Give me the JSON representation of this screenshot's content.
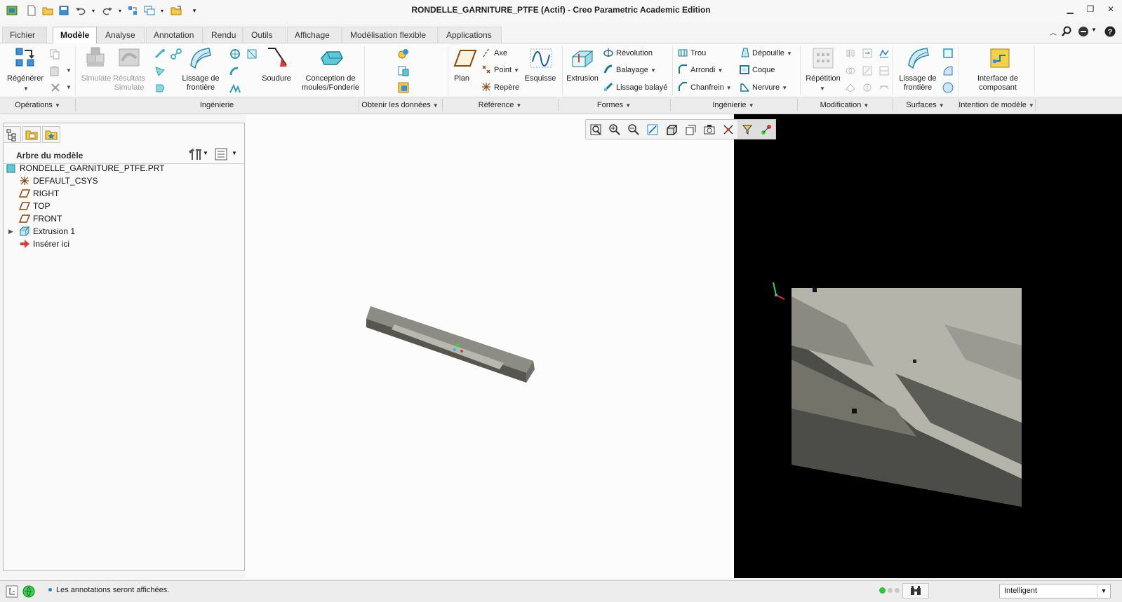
{
  "window": {
    "title": "RONDELLE_GARNITURE_PTFE (Actif) - Creo Parametric Academic Edition"
  },
  "tabs": [
    {
      "label": "Fichier"
    },
    {
      "label": "Modèle"
    },
    {
      "label": "Analyse"
    },
    {
      "label": "Annotation"
    },
    {
      "label": "Rendu"
    },
    {
      "label": "Outils"
    },
    {
      "label": "Affichage"
    },
    {
      "label": "Modélisation flexible"
    },
    {
      "label": "Applications"
    }
  ],
  "ribbon": {
    "operations": {
      "regenerate": "Régénérer"
    },
    "engineering": {
      "simulate": "Simulate",
      "results_simulate_1": "Résultats",
      "results_simulate_2": "Simulate",
      "boundary_blend_1": "Lissage de",
      "boundary_blend_2": "frontière",
      "weld": "Soudure",
      "mold_1": "Conception de",
      "mold_2": "moules/Fonderie"
    },
    "datum": {
      "plane": "Plan",
      "axis": "Axe",
      "point": "Point",
      "csys": "Repère",
      "sketch": "Esquisse"
    },
    "shapes": {
      "extrude": "Extrusion",
      "revolve": "Révolution",
      "sweep": "Balayage",
      "swept_blend": "Lissage balayé"
    },
    "eng2": {
      "hole": "Trou",
      "round": "Arrondi",
      "chamfer": "Chanfrein",
      "draft": "Dépouille",
      "shell": "Coque",
      "rib": "Nervure"
    },
    "editing": {
      "pattern": "Répétition"
    },
    "surfaces": {
      "boundary_blend_1": "Lissage de",
      "boundary_blend_2": "frontière"
    },
    "intent": {
      "component_interface_1": "Interface de",
      "component_interface_2": "composant"
    }
  },
  "groups": [
    {
      "label": "Opérations"
    },
    {
      "label": "Ingénierie"
    },
    {
      "label": "Obtenir les données"
    },
    {
      "label": "Référence"
    },
    {
      "label": "Formes"
    },
    {
      "label": "Ingénierie"
    },
    {
      "label": "Modification"
    },
    {
      "label": "Surfaces"
    },
    {
      "label": "Intention de modèle"
    }
  ],
  "model_tree": {
    "header": "Arbre du modèle",
    "items": [
      {
        "label": "RONDELLE_GARNITURE_PTFE.PRT",
        "icon": "part-icon"
      },
      {
        "label": "DEFAULT_CSYS",
        "icon": "csys-icon"
      },
      {
        "label": "RIGHT",
        "icon": "datum-plane-icon"
      },
      {
        "label": "TOP",
        "icon": "datum-plane-icon"
      },
      {
        "label": "FRONT",
        "icon": "datum-plane-icon"
      },
      {
        "label": "Extrusion 1",
        "icon": "extrude-icon"
      },
      {
        "label": "Insérer ici",
        "icon": "insert-arrow-icon"
      }
    ]
  },
  "status": {
    "message": "Les annotations seront affichées.",
    "filter_value": "Intelligent"
  },
  "colors": {
    "accent": "#2d7fc1",
    "part_gray": "#6b6b66",
    "black_area": "#000000"
  }
}
